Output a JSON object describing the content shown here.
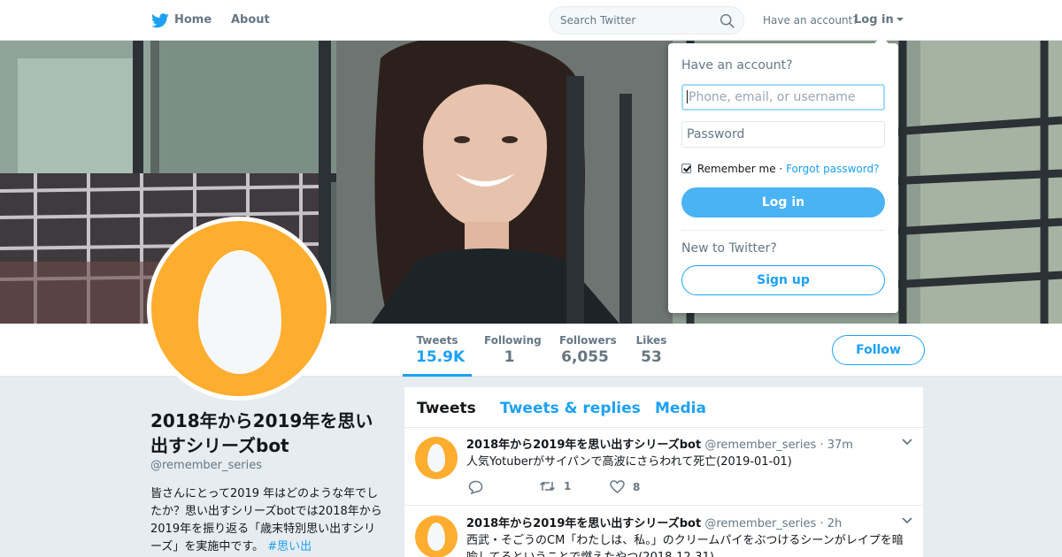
{
  "nav": {
    "home_label": "Home",
    "about_label": "About",
    "search_placeholder": "Search Twitter",
    "have_account": "Have an account?",
    "login_label": "Log in",
    "logo_icon": "twitter-bird-icon"
  },
  "colors": {
    "accent": "#1da1f2",
    "egg_avatar": "#ffad2f",
    "login_button": "#4ab3f4"
  },
  "banner": {
    "image": "header photo of a smiling woman with dark hair in front of a window"
  },
  "profile": {
    "name": "2018年から2019年を思い出すシリーズbot",
    "handle": "@remember_series",
    "bio_text": "皆さんにとって2019 年はどのような年でしたか？思い出すシリーズbotでは2018年から2019年を振り返る「歳末特別思い出すシリーズ」を実施中です。",
    "bio_hashtag": "#思い出"
  },
  "stats": [
    {
      "label": "Tweets",
      "value": "15.9K"
    },
    {
      "label": "Following",
      "value": "1"
    },
    {
      "label": "Followers",
      "value": "6,055"
    },
    {
      "label": "Likes",
      "value": "53"
    }
  ],
  "follow_label": "Follow",
  "timeline": {
    "tabs": [
      "Tweets",
      "Tweets & replies",
      "Media"
    ],
    "tweets": [
      {
        "name": "2018年から2019年を思い出すシリーズbot",
        "handle": "@remember_series",
        "time": "37m",
        "text": "人気Yotuberがサイパンで高波にさらわれて死亡(2019-01-01)",
        "retweets": "1",
        "likes": "8"
      },
      {
        "name": "2018年から2019年を思い出すシリーズbot",
        "handle": "@remember_series",
        "time": "2h",
        "text": "西武・そごうのCM「わたしは、私。」のクリームパイをぶつけるシーンがレイプを暗喩してるということで燃えたやつ(2018-12-31)"
      }
    ]
  },
  "login_dropdown": {
    "title": "Have an account?",
    "username_placeholder": "Phone, email, or username",
    "password_placeholder": "Password",
    "remember_me": "Remember me",
    "separator": "·",
    "forgot_password": "Forgot password?",
    "remember_checked": true,
    "login_button": "Log in",
    "new_to_twitter": "New to Twitter?",
    "signup_button": "Sign up"
  }
}
